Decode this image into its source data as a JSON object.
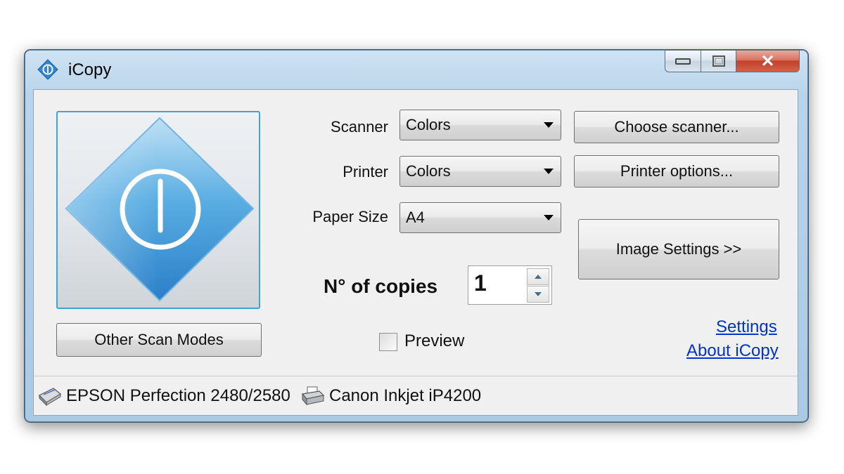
{
  "window": {
    "title": "iCopy",
    "controls": {
      "minimize": "▭",
      "maximize": "▢",
      "close": "✕"
    }
  },
  "left_panel": {
    "scan_tile_icon": "power-icon",
    "other_scan_modes_label": "Other Scan Modes"
  },
  "form": {
    "scanner": {
      "label": "Scanner",
      "value": "Colors"
    },
    "printer": {
      "label": "Printer",
      "value": "Colors"
    },
    "paper_size": {
      "label": "Paper Size",
      "value": "A4"
    },
    "copies": {
      "label": "N° of copies",
      "value": "1"
    },
    "preview": {
      "label": "Preview",
      "checked": false
    }
  },
  "buttons": {
    "choose_scanner": "Choose scanner...",
    "printer_options": "Printer options...",
    "image_settings": "Image Settings >>"
  },
  "links": {
    "settings": "Settings",
    "about": "About iCopy"
  },
  "statusbar": {
    "scanner_name": "EPSON Perfection 2480/2580",
    "printer_name": "Canon Inkjet iP4200"
  },
  "colors": {
    "accent": "#3fa3d6",
    "link": "#0033cc",
    "close_button": "#c4402a"
  }
}
